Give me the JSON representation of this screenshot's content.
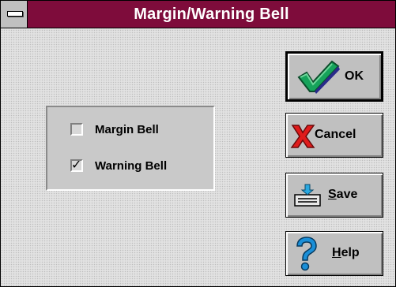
{
  "window": {
    "title": "Margin/Warning Bell"
  },
  "options": [
    {
      "label": "Margin Bell",
      "checked": false
    },
    {
      "label": "Warning Bell",
      "checked": true
    }
  ],
  "buttons": {
    "ok": {
      "label": "OK",
      "icon": "checkmark-icon"
    },
    "cancel": {
      "label": "Cancel",
      "icon": "red-x-icon"
    },
    "save": {
      "label": "Save",
      "mnemonic": "S",
      "rest": "ave",
      "icon": "save-tray-icon"
    },
    "help": {
      "label": "Help",
      "mnemonic": "H",
      "rest": "elp",
      "icon": "question-mark-icon"
    }
  },
  "colors": {
    "titlebar": "#7e0c3b",
    "face": "#c0c0c0"
  }
}
